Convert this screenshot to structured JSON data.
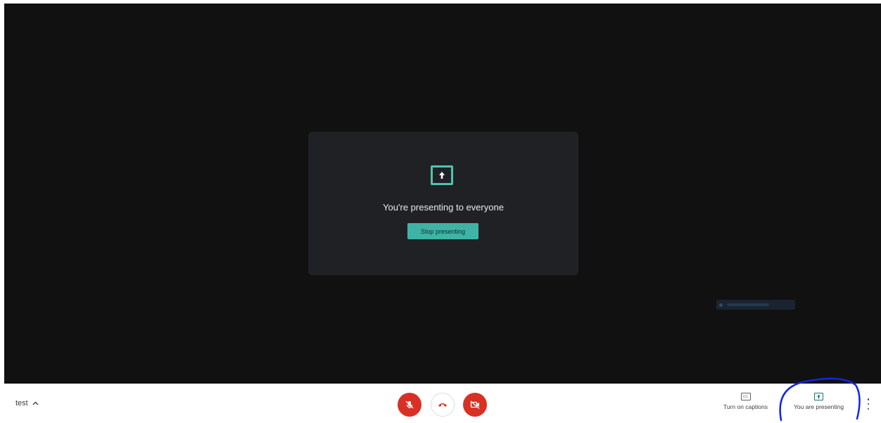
{
  "stage": {
    "present_message": "You're presenting to everyone",
    "stop_button_label": "Stop presenting",
    "present_icon": "present-to-all-icon"
  },
  "bottom_bar": {
    "meeting_name": "test",
    "meeting_chevron_icon": "chevron-up-icon",
    "mic_icon": "mic-off-icon",
    "hangup_icon": "call-end-icon",
    "camera_icon": "videocam-off-icon",
    "captions": {
      "icon": "closed-captions-icon",
      "icon_text": "CC",
      "label": "Turn on captions"
    },
    "presenting": {
      "icon": "present-to-all-icon",
      "label": "You are presenting"
    },
    "more_icon": "more-vert-icon"
  },
  "colors": {
    "stage_bg": "#111111",
    "card_bg": "#202124",
    "accent_teal": "#3fb3a5",
    "danger_red": "#d93025",
    "annotation_blue": "#1326e8"
  }
}
